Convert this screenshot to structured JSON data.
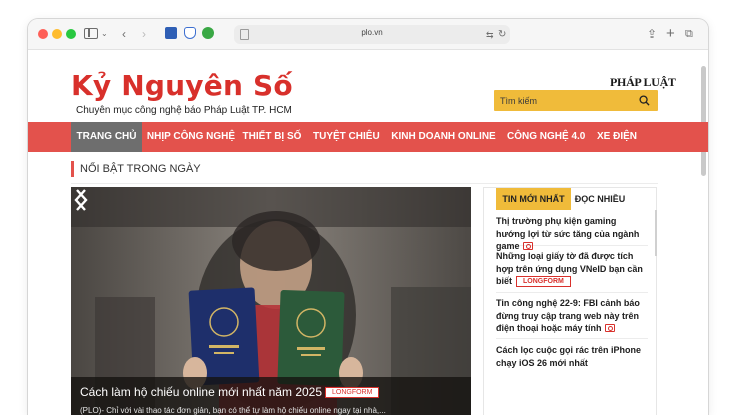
{
  "browser": {
    "address": "plo.vn"
  },
  "site": {
    "logo": "Kỷ Nguyên Số",
    "tagline": "Chuyên mục công nghệ báo Pháp Luật TP. HCM",
    "partner_logo": "PHÁP LUẬT",
    "search_placeholder": "Tìm kiếm"
  },
  "nav": {
    "items": [
      {
        "label": "TRANG CHỦ"
      },
      {
        "label": "NHỊP CÔNG NGHỆ"
      },
      {
        "label": "THIẾT BỊ SỐ"
      },
      {
        "label": "TUYỆT CHIÊU"
      },
      {
        "label": "KINH DOANH ONLINE"
      },
      {
        "label": "CÔNG NGHỆ 4.0"
      },
      {
        "label": "XE ĐIỆN"
      }
    ],
    "active_index": 0
  },
  "section": {
    "title": "NỔI BẬT TRONG NGÀY"
  },
  "hero": {
    "title": "Cách làm hộ chiếu online mới nhất năm 2025",
    "badge": "LONGFORM",
    "summary": "(PLO)- Chỉ với vài thao tác đơn giản, bạn có thể tự làm hộ chiếu online ngay tại nhà,..."
  },
  "sidebar": {
    "tabs": [
      {
        "label": "TIN MỚI NHẤT"
      },
      {
        "label": "ĐỌC NHIỀU"
      }
    ],
    "news": [
      {
        "title": "Thị trường phụ kiện gaming hướng lợi từ sức tăng của ngành game",
        "icon": "camera-icon"
      },
      {
        "title": "Những loại giấy tờ đã được tích hợp trên ứng dụng VNeID bạn cần biết",
        "badge": "LONGFORM"
      },
      {
        "title": "Tin công nghệ 22-9: FBI cảnh báo đừng truy cập trang web này trên điện thoại hoặc máy tính",
        "icon": "camera-icon"
      },
      {
        "title": "Cách lọc cuộc gọi rác trên iPhone chạy iOS 26 mới nhất"
      }
    ]
  },
  "colors": {
    "brand_red": "#d8302b",
    "nav_red": "#e3524c",
    "search_yellow": "#f0bb3a",
    "nav_active": "#6e6e6e"
  }
}
